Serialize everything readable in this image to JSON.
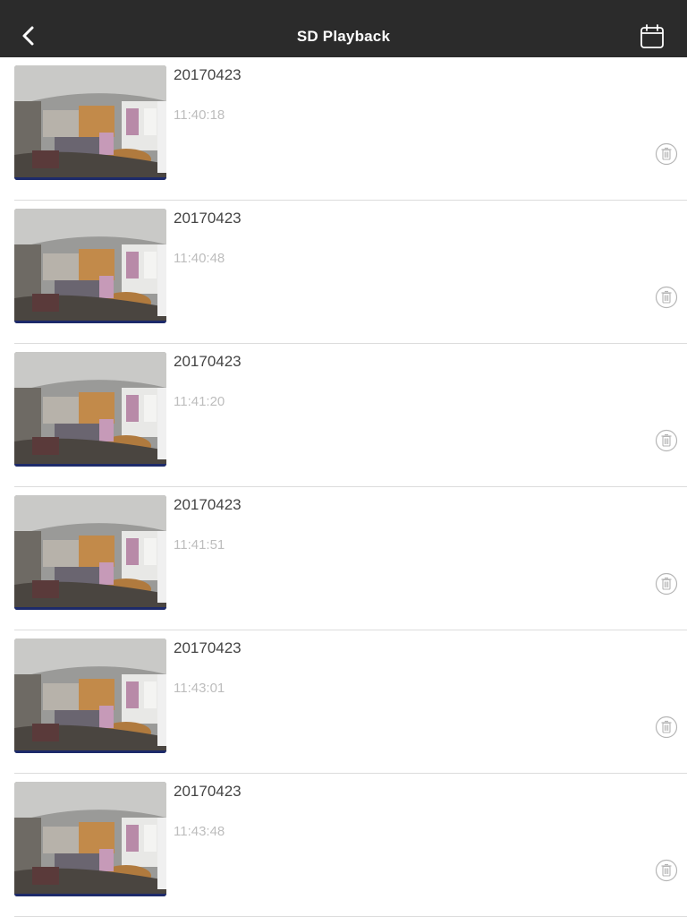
{
  "header": {
    "title": "SD Playback",
    "back_icon": "chevron-left-icon",
    "calendar_icon": "calendar-icon"
  },
  "recordings": [
    {
      "date": "20170423",
      "time": "11:40:18"
    },
    {
      "date": "20170423",
      "time": "11:40:48"
    },
    {
      "date": "20170423",
      "time": "11:41:20"
    },
    {
      "date": "20170423",
      "time": "11:41:51"
    },
    {
      "date": "20170423",
      "time": "11:43:01"
    },
    {
      "date": "20170423",
      "time": "11:43:48"
    }
  ],
  "colors": {
    "navbar": "#2b2b2b",
    "date_text": "#444444",
    "time_text": "#bdbdbd",
    "divider": "#dcdcdc",
    "delete_icon": "#b5b5b5"
  }
}
